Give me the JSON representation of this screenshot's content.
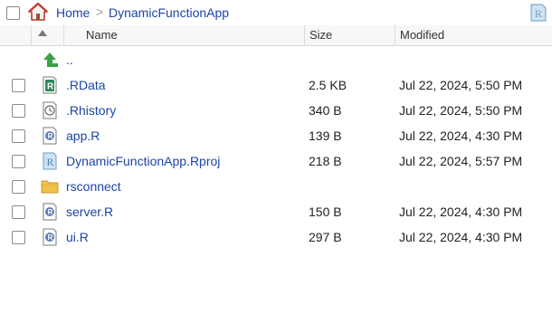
{
  "breadcrumb": {
    "home_label": "Home",
    "separator": ">",
    "current_label": "DynamicFunctionApp"
  },
  "columns": {
    "name": "Name",
    "size": "Size",
    "modified": "Modified"
  },
  "parent_row": {
    "label": "..",
    "icon": "up-arrow-icon"
  },
  "files": [
    {
      "name": ".RData",
      "size": "2.5 KB",
      "modified": "Jul 22, 2024, 5:50 PM",
      "icon": "rdata-icon"
    },
    {
      "name": ".Rhistory",
      "size": "340 B",
      "modified": "Jul 22, 2024, 5:50 PM",
      "icon": "history-icon"
    },
    {
      "name": "app.R",
      "size": "139 B",
      "modified": "Jul 22, 2024, 4:30 PM",
      "icon": "r-file-icon"
    },
    {
      "name": "DynamicFunctionApp.Rproj",
      "size": "218 B",
      "modified": "Jul 22, 2024, 5:57 PM",
      "icon": "rproj-icon"
    },
    {
      "name": "rsconnect",
      "size": "",
      "modified": "",
      "icon": "folder-icon"
    },
    {
      "name": "server.R",
      "size": "150 B",
      "modified": "Jul 22, 2024, 4:30 PM",
      "icon": "r-file-icon"
    },
    {
      "name": "ui.R",
      "size": "297 B",
      "modified": "Jul 22, 2024, 4:30 PM",
      "icon": "r-file-icon"
    }
  ],
  "colors": {
    "link": "#1c45a5",
    "header_bg": "#f7f7f7",
    "folder": "#f0c24b",
    "up_arrow": "#3aa04a"
  }
}
